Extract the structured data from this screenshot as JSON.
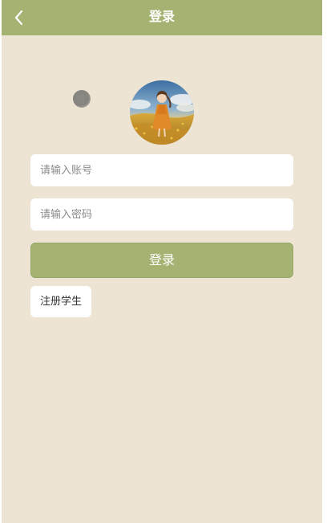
{
  "header": {
    "title": "登录",
    "back_icon": "chevron-left-icon",
    "background": "#a4b372"
  },
  "page": {
    "background": "#ede4d4"
  },
  "avatar": {
    "description_icon": "avatar-illustration"
  },
  "form": {
    "account": {
      "placeholder": "请输入账号",
      "value": ""
    },
    "password": {
      "placeholder": "请输入密码",
      "value": ""
    },
    "login_label": "登录",
    "register_label": "注册学生"
  },
  "colors": {
    "accent": "#a4b372",
    "field_bg": "#ffffff",
    "text": "#333333"
  }
}
